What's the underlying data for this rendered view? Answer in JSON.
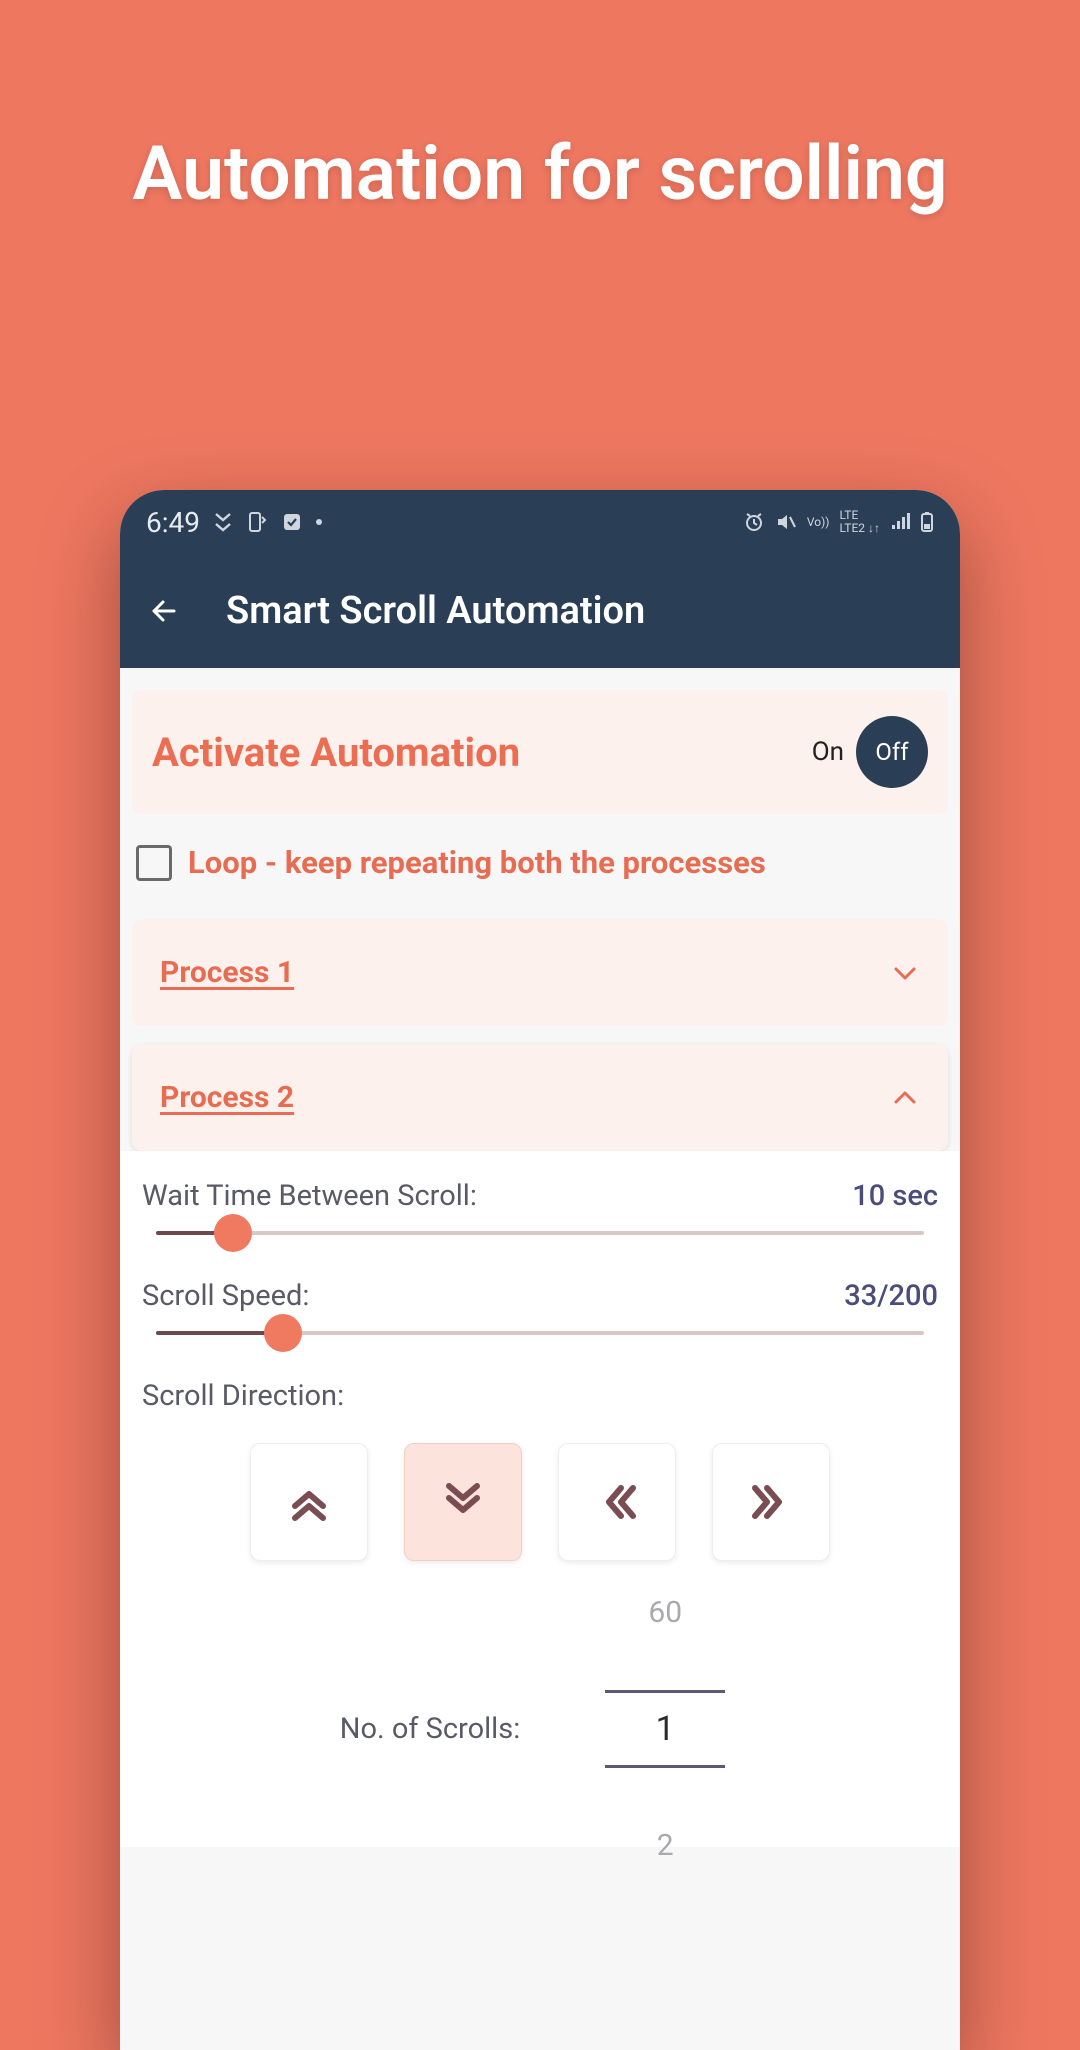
{
  "promo": {
    "title": "Automation for scrolling"
  },
  "status_bar": {
    "time": "6:49",
    "icons_left": [
      "double-chevron-down",
      "phone-sync",
      "shield-check",
      "dot"
    ],
    "icons_right": [
      "alarm",
      "volume-mute",
      "vowifi",
      "lte-lte2",
      "signal",
      "battery"
    ]
  },
  "app_bar": {
    "title": "Smart Scroll Automation"
  },
  "activate": {
    "label": "Activate Automation",
    "on_text": "On",
    "off_text": "Off",
    "state": "off"
  },
  "loop": {
    "checked": false,
    "label": "Loop - keep repeating both the processes"
  },
  "processes": [
    {
      "title": "Process 1",
      "expanded": false
    },
    {
      "title": "Process 2",
      "expanded": true
    }
  ],
  "process2": {
    "wait_time": {
      "label": "Wait Time Between Scroll:",
      "value_text": "10 sec",
      "value": 10,
      "max": 100,
      "fill_pct": 10
    },
    "speed": {
      "label": "Scroll Speed:",
      "value_text": "33/200",
      "value": 33,
      "max": 200,
      "fill_pct": 16.5
    },
    "direction": {
      "label": "Scroll Direction:",
      "options": [
        "up",
        "down",
        "left",
        "right"
      ],
      "selected": "down"
    },
    "num_scrolls": {
      "label": "No. of Scrolls:",
      "prev": "60",
      "current": "1",
      "next": "2"
    }
  },
  "colors": {
    "background": "#ee7760",
    "appbar": "#2a3e55",
    "accent": "#ec6d52",
    "card": "#fdf1ed",
    "value": "#4a4d7c"
  }
}
